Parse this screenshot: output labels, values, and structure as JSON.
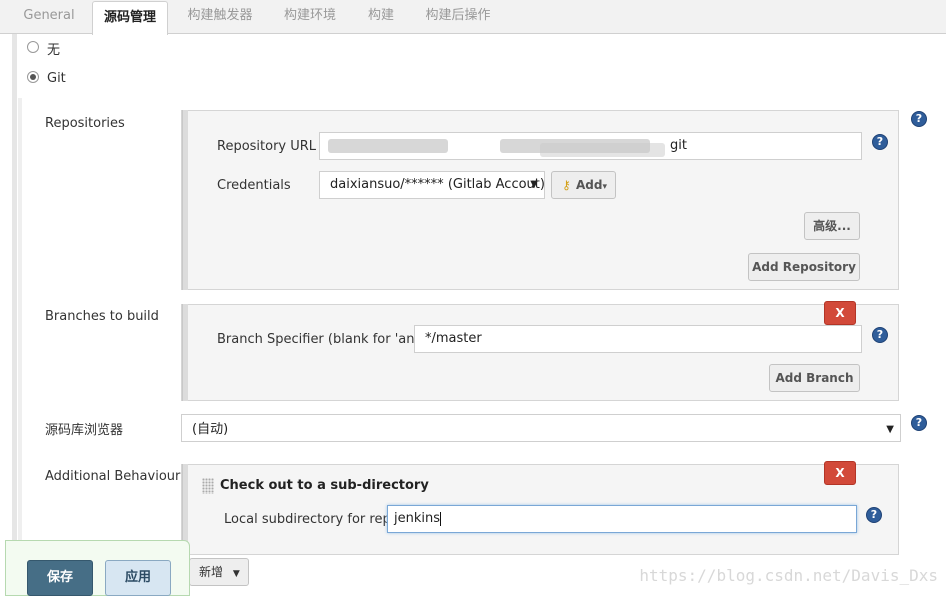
{
  "tabs": [
    "General",
    "源码管理",
    "构建触发器",
    "构建环境",
    "构建",
    "构建后操作"
  ],
  "scm": {
    "none_label": "无",
    "git_label": "Git"
  },
  "repositories": {
    "label": "Repositories",
    "url_label": "Repository URL",
    "url_value": "git",
    "credentials_label": "Credentials",
    "credentials_value": "daixiansuo/****** (Gitlab  Accout)",
    "add_label": "Add",
    "advanced_label": "高级...",
    "add_repository_label": "Add Repository"
  },
  "branches": {
    "label": "Branches to build",
    "specifier_label": "Branch Specifier (blank for 'any')",
    "specifier_value": "*/master",
    "add_branch_label": "Add Branch",
    "delete_label": "X"
  },
  "browser": {
    "label": "源码库浏览器",
    "value": "(自动)"
  },
  "behaviours": {
    "label": "Additional Behaviours",
    "item_title": "Check out to a sub-directory",
    "subdir_label": "Local subdirectory for repo",
    "subdir_value": "jenkins",
    "delete_label": "X",
    "add_label": "新增"
  },
  "footer": {
    "save_label": "保存",
    "apply_label": "应用"
  },
  "help_glyph": "?",
  "watermark": "https://blog.csdn.net/Davis_Dxs",
  "colors": {
    "delete": "#d24939",
    "help": "#2f5d9a",
    "save": "#466e86",
    "apply": "#d7e6f2"
  }
}
